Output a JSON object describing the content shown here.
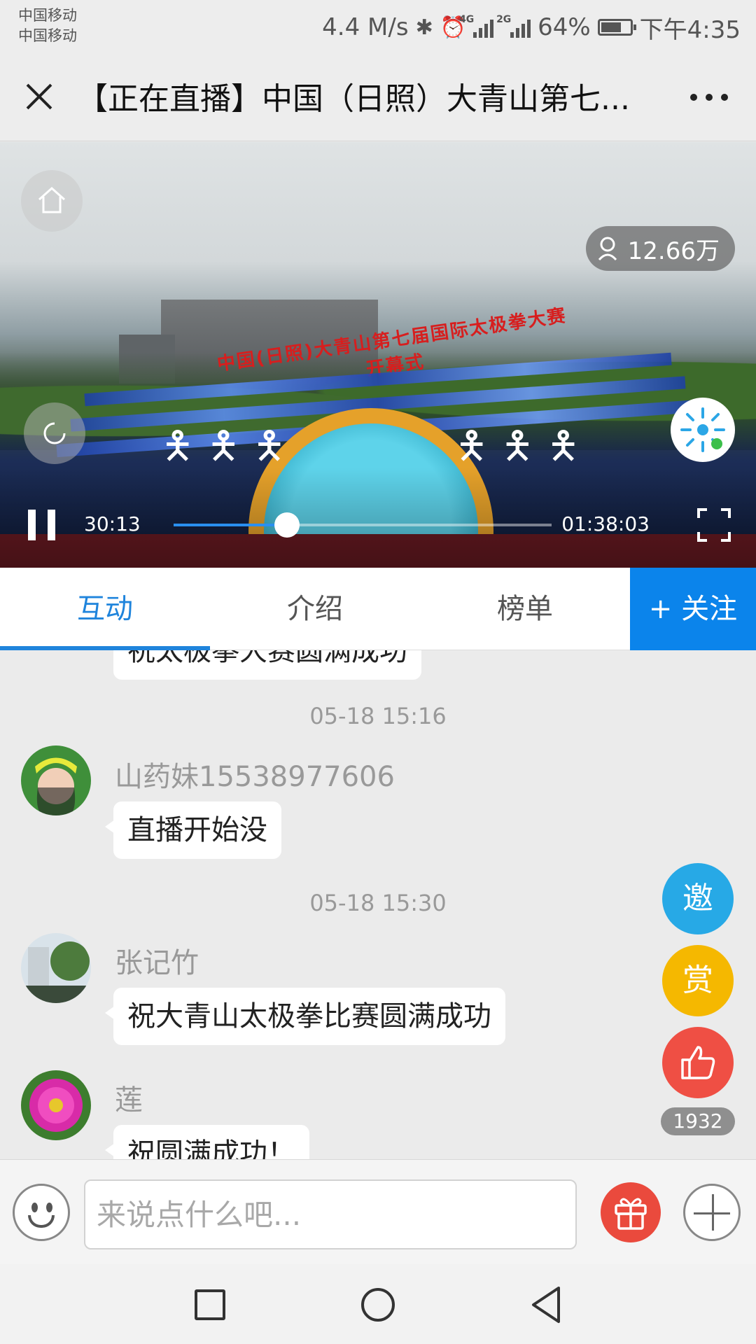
{
  "status_bar": {
    "carrier_1": "中国移动",
    "carrier_2": "中国移动",
    "speed": "4.4 M/s",
    "network_1": "4G",
    "network_2": "2G",
    "battery": "64%",
    "time": "下午4:35"
  },
  "header": {
    "title": "【正在直播】中国（日照）大青山第七..."
  },
  "video": {
    "viewers": "12.66万",
    "current_time": "30:13",
    "total_time": "01:38:03",
    "progress": 0.3,
    "stage_banner": "中国(日照)大青山第七届国际太极拳大赛开幕式"
  },
  "tabs": {
    "items": [
      {
        "label": "互动"
      },
      {
        "label": "介绍"
      },
      {
        "label": "榜单"
      }
    ],
    "follow": "+ 关注"
  },
  "chat": {
    "partial_top_message": "祝太极拳大赛圆满成功",
    "messages": [
      {
        "timestamp": "05-18 15:16",
        "user": "山药妹15538977606",
        "text": "直播开始没"
      },
      {
        "timestamp": "05-18 15:30",
        "user": "张记竹",
        "text": "祝大青山太极拳比赛圆满成功"
      },
      {
        "user": "莲",
        "text": "祝圆满成功！"
      }
    ]
  },
  "side_actions": {
    "invite": "邀",
    "reward": "赏",
    "like_count": "1932",
    "colors": {
      "invite": "#27a9e6",
      "reward": "#f5b800",
      "like": "#ef4f44"
    }
  },
  "input_bar": {
    "placeholder": "来说点什么吧..."
  }
}
